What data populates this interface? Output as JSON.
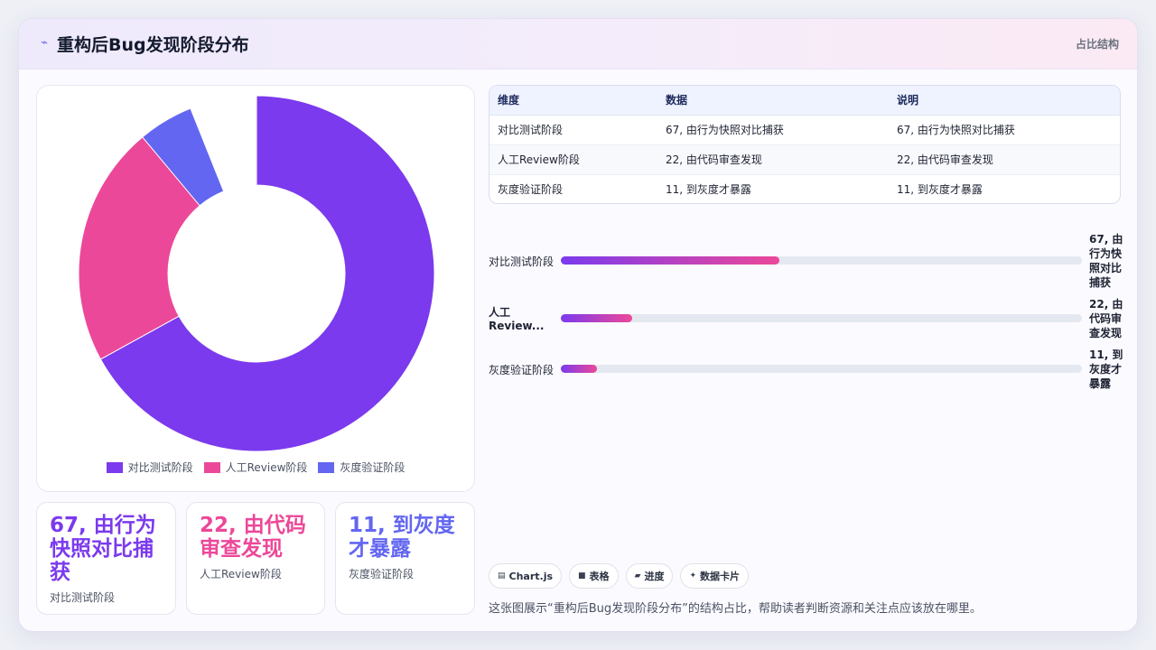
{
  "header": {
    "icon": "sparkline-icon",
    "title": "重构后Bug发现阶段分布",
    "tag": "占比结构"
  },
  "colors": {
    "purple": "#7b3aed",
    "pink": "#ec4899",
    "indigo": "#6366f1"
  },
  "chart_data": {
    "type": "pie",
    "variant": "doughnut",
    "categories": [
      "对比测试阶段",
      "人工Review阶段",
      "灰度验证阶段"
    ],
    "values": [
      67,
      22,
      11
    ],
    "colors": [
      "#7b3aed",
      "#ec4899",
      "#6366f1"
    ],
    "legend_position": "bottom"
  },
  "stats": [
    {
      "value": "67, 由行为快照对比捕获",
      "label": "对比测试阶段",
      "color": "#7b3aed"
    },
    {
      "value": "22, 由代码审查发现",
      "label": "人工Review阶段",
      "color": "#ec4899"
    },
    {
      "value": "11, 到灰度才暴露",
      "label": "灰度验证阶段",
      "color": "#6366f1"
    }
  ],
  "table": {
    "headers": [
      "维度",
      "数据",
      "说明"
    ],
    "rows": [
      [
        "对比测试阶段",
        "67, 由行为快照对比捕获",
        "67, 由行为快照对比捕获"
      ],
      [
        "人工Review阶段",
        "22, 由代码审查发现",
        "22, 由代码审查发现"
      ],
      [
        "灰度验证阶段",
        "11, 到灰度才暴露",
        "11, 到灰度才暴露"
      ]
    ]
  },
  "progress": [
    {
      "label": "对比测试阶段",
      "value_text": "67, 由行为快照对比捕获",
      "percent": 67
    },
    {
      "label": "人工Review...",
      "value_text": "22, 由代码审查发现",
      "percent": 22
    },
    {
      "label": "灰度验证阶段",
      "value_text": "11, 到灰度才暴露",
      "percent": 11
    }
  ],
  "chips": [
    {
      "icon": "chart-icon",
      "glyph": "▤",
      "label": "Chart.js"
    },
    {
      "icon": "table-icon",
      "glyph": "■",
      "label": "表格"
    },
    {
      "icon": "progress-icon",
      "glyph": "▰",
      "label": "进度"
    },
    {
      "icon": "sparkle-icon",
      "glyph": "✦",
      "label": "数据卡片"
    }
  ],
  "caption": "这张图展示“重构后Bug发现阶段分布”的结构占比，帮助读者判断资源和关注点应该放在哪里。"
}
